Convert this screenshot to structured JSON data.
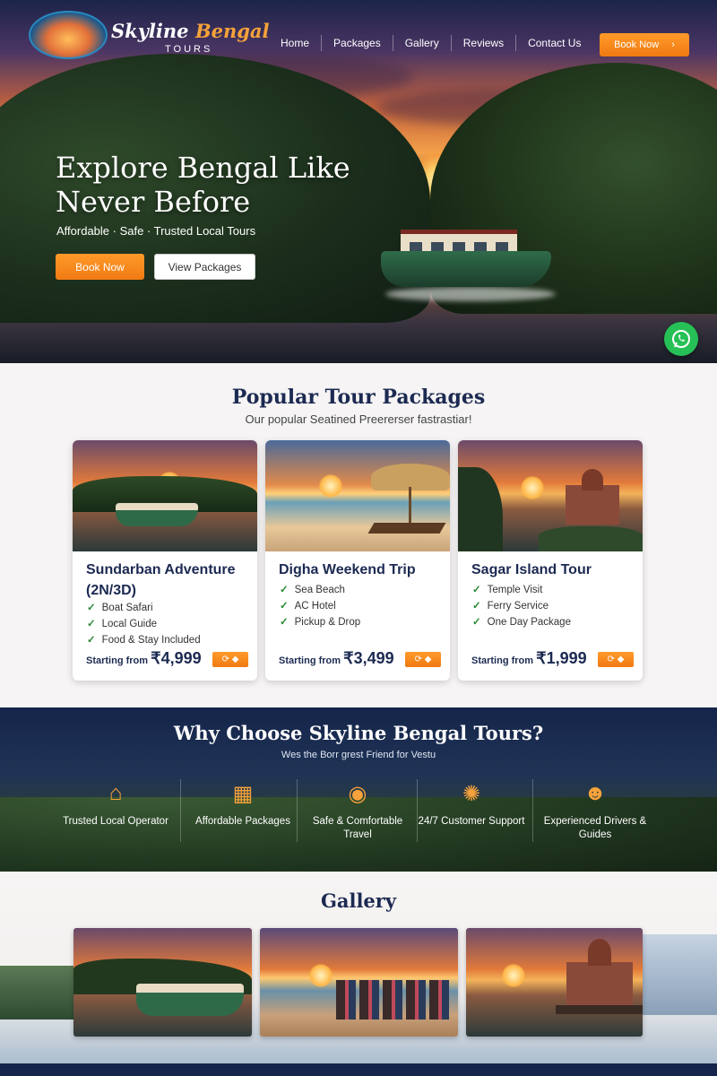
{
  "brand": {
    "name_part1": "Skyline",
    "name_part2": "Bengal",
    "sub": "TOURS"
  },
  "nav": {
    "items": [
      "Home",
      "Packages",
      "Gallery",
      "Reviews",
      "Contact Us"
    ],
    "cta": "Book Now",
    "cta_arrow": "›"
  },
  "hero": {
    "title": "Explore Bengal Like Never Before",
    "tagline": "Affordable · Safe · Trusted Local Tours",
    "btn_primary": "Book Now",
    "btn_secondary": "View Packages"
  },
  "packages": {
    "title": "Popular Tour Packages",
    "subtitle": "Our popular Seatined Preererser fastrastiar!",
    "starting_label": "Starting from",
    "currency": "₹",
    "cards": [
      {
        "title": "Sundarban Adventure (2N/3D)",
        "features": [
          "Boat Safari",
          "Local Guide",
          "Food & Stay Included"
        ],
        "price": "4,999"
      },
      {
        "title": "Digha Weekend Trip",
        "features": [
          "Sea Beach",
          "AC Hotel",
          "Pickup & Drop"
        ],
        "price": "3,499"
      },
      {
        "title": "Sagar Island Tour",
        "features": [
          "Temple Visit",
          "Ferry Service",
          "One Day Package"
        ],
        "price": "1,999"
      }
    ]
  },
  "why": {
    "title": "Why Choose Skyline Bengal Tours?",
    "subtitle": "Wes the Borr grest Friend for Vestu",
    "features": [
      {
        "label": "Trusted Local Operator",
        "icon": "house-icon"
      },
      {
        "label": "Affordable Packages",
        "icon": "bus-icon"
      },
      {
        "label": "Safe & Comfortable Travel",
        "icon": "shield-icon"
      },
      {
        "label": "24/7 Customer Support",
        "icon": "support-icon"
      },
      {
        "label": "Experienced Drivers & Guides",
        "icon": "group-icon"
      }
    ]
  },
  "gallery": {
    "title": "Gallery"
  },
  "colors": {
    "accent": "#f6a23a",
    "navy": "#1c2a52",
    "whatsapp": "#26c056"
  }
}
